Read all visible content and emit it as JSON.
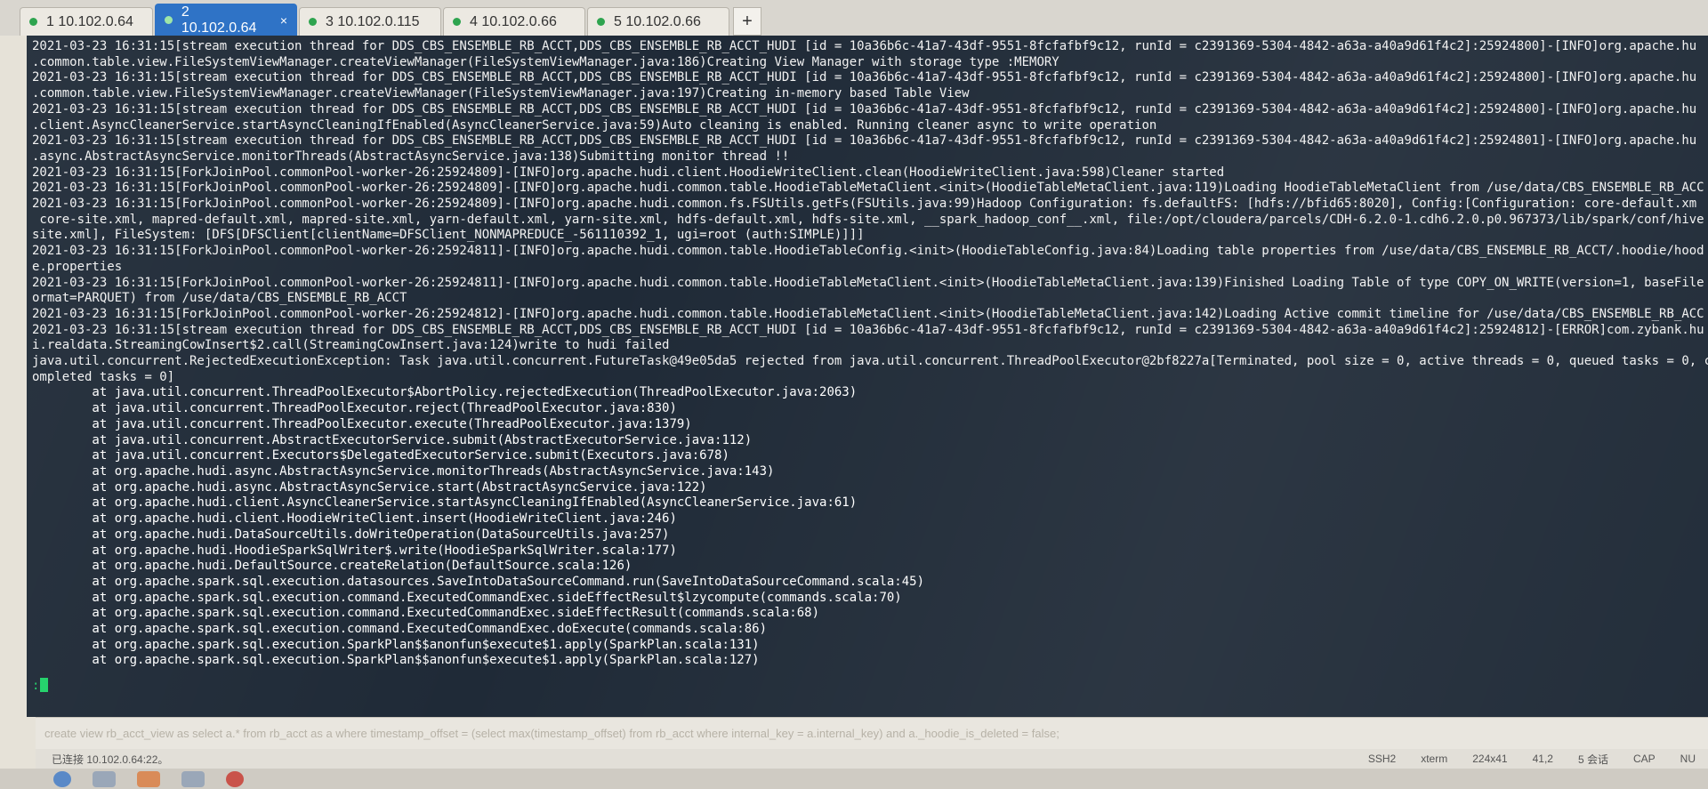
{
  "tabs": [
    {
      "label": "1 10.102.0.64",
      "active": false
    },
    {
      "label": "2 10.102.0.64",
      "active": true
    },
    {
      "label": "3 10.102.0.115",
      "active": false
    },
    {
      "label": "4 10.102.0.66",
      "active": false
    },
    {
      "label": "5 10.102.0.66",
      "active": false
    }
  ],
  "tab_add_label": "+",
  "tab_close_label": "×",
  "log_lines": [
    "2021-03-23 16:31:15[stream execution thread for DDS_CBS_ENSEMBLE_RB_ACCT,DDS_CBS_ENSEMBLE_RB_ACCT_HUDI [id = 10a36b6c-41a7-43df-9551-8fcfafbf9c12, runId = c2391369-5304-4842-a63a-a40a9d61f4c2]:25924800]-[INFO]org.apache.hu",
    ".common.table.view.FileSystemViewManager.createViewManager(FileSystemViewManager.java:186)Creating View Manager with storage type :MEMORY",
    "2021-03-23 16:31:15[stream execution thread for DDS_CBS_ENSEMBLE_RB_ACCT,DDS_CBS_ENSEMBLE_RB_ACCT_HUDI [id = 10a36b6c-41a7-43df-9551-8fcfafbf9c12, runId = c2391369-5304-4842-a63a-a40a9d61f4c2]:25924800]-[INFO]org.apache.hu",
    ".common.table.view.FileSystemViewManager.createViewManager(FileSystemViewManager.java:197)Creating in-memory based Table View",
    "2021-03-23 16:31:15[stream execution thread for DDS_CBS_ENSEMBLE_RB_ACCT,DDS_CBS_ENSEMBLE_RB_ACCT_HUDI [id = 10a36b6c-41a7-43df-9551-8fcfafbf9c12, runId = c2391369-5304-4842-a63a-a40a9d61f4c2]:25924800]-[INFO]org.apache.hu",
    ".client.AsyncCleanerService.startAsyncCleaningIfEnabled(AsyncCleanerService.java:59)Auto cleaning is enabled. Running cleaner async to write operation",
    "2021-03-23 16:31:15[stream execution thread for DDS_CBS_ENSEMBLE_RB_ACCT,DDS_CBS_ENSEMBLE_RB_ACCT_HUDI [id = 10a36b6c-41a7-43df-9551-8fcfafbf9c12, runId = c2391369-5304-4842-a63a-a40a9d61f4c2]:25924801]-[INFO]org.apache.hu",
    ".async.AbstractAsyncService.monitorThreads(AbstractAsyncService.java:138)Submitting monitor thread !!",
    "2021-03-23 16:31:15[ForkJoinPool.commonPool-worker-26:25924809]-[INFO]org.apache.hudi.client.HoodieWriteClient.clean(HoodieWriteClient.java:598)Cleaner started",
    "2021-03-23 16:31:15[ForkJoinPool.commonPool-worker-26:25924809]-[INFO]org.apache.hudi.common.table.HoodieTableMetaClient.<init>(HoodieTableMetaClient.java:119)Loading HoodieTableMetaClient from /use/data/CBS_ENSEMBLE_RB_ACC",
    "2021-03-23 16:31:15[ForkJoinPool.commonPool-worker-26:25924809]-[INFO]org.apache.hudi.common.fs.FSUtils.getFs(FSUtils.java:99)Hadoop Configuration: fs.defaultFS: [hdfs://bfid65:8020], Config:[Configuration: core-default.xm",
    " core-site.xml, mapred-default.xml, mapred-site.xml, yarn-default.xml, yarn-site.xml, hdfs-default.xml, hdfs-site.xml, __spark_hadoop_conf__.xml, file:/opt/cloudera/parcels/CDH-6.2.0-1.cdh6.2.0.p0.967373/lib/spark/conf/hive",
    "site.xml], FileSystem: [DFS[DFSClient[clientName=DFSClient_NONMAPREDUCE_-561110392_1, ugi=root (auth:SIMPLE)]]]",
    "2021-03-23 16:31:15[ForkJoinPool.commonPool-worker-26:25924811]-[INFO]org.apache.hudi.common.table.HoodieTableConfig.<init>(HoodieTableConfig.java:84)Loading table properties from /use/data/CBS_ENSEMBLE_RB_ACCT/.hoodie/hood",
    "e.properties",
    "2021-03-23 16:31:15[ForkJoinPool.commonPool-worker-26:25924811]-[INFO]org.apache.hudi.common.table.HoodieTableMetaClient.<init>(HoodieTableMetaClient.java:139)Finished Loading Table of type COPY_ON_WRITE(version=1, baseFile",
    "ormat=PARQUET) from /use/data/CBS_ENSEMBLE_RB_ACCT",
    "2021-03-23 16:31:15[ForkJoinPool.commonPool-worker-26:25924812]-[INFO]org.apache.hudi.common.table.HoodieTableMetaClient.<init>(HoodieTableMetaClient.java:142)Loading Active commit timeline for /use/data/CBS_ENSEMBLE_RB_ACC",
    "2021-03-23 16:31:15[stream execution thread for DDS_CBS_ENSEMBLE_RB_ACCT,DDS_CBS_ENSEMBLE_RB_ACCT_HUDI [id = 10a36b6c-41a7-43df-9551-8fcfafbf9c12, runId = c2391369-5304-4842-a63a-a40a9d61f4c2]:25924812]-[ERROR]com.zybank.hu",
    "i.realdata.StreamingCowInsert$2.call(StreamingCowInsert.java:124)write to hudi failed",
    "java.util.concurrent.RejectedExecutionException: Task java.util.concurrent.FutureTask@49e05da5 rejected from java.util.concurrent.ThreadPoolExecutor@2bf8227a[Terminated, pool size = 0, active threads = 0, queued tasks = 0, c",
    "ompleted tasks = 0]",
    "        at java.util.concurrent.ThreadPoolExecutor$AbortPolicy.rejectedExecution(ThreadPoolExecutor.java:2063)",
    "        at java.util.concurrent.ThreadPoolExecutor.reject(ThreadPoolExecutor.java:830)",
    "        at java.util.concurrent.ThreadPoolExecutor.execute(ThreadPoolExecutor.java:1379)",
    "        at java.util.concurrent.AbstractExecutorService.submit(AbstractExecutorService.java:112)",
    "        at java.util.concurrent.Executors$DelegatedExecutorService.submit(Executors.java:678)",
    "        at org.apache.hudi.async.AbstractAsyncService.monitorThreads(AbstractAsyncService.java:143)",
    "        at org.apache.hudi.async.AbstractAsyncService.start(AbstractAsyncService.java:122)",
    "        at org.apache.hudi.client.AsyncCleanerService.startAsyncCleaningIfEnabled(AsyncCleanerService.java:61)",
    "        at org.apache.hudi.client.HoodieWriteClient.insert(HoodieWriteClient.java:246)",
    "        at org.apache.hudi.DataSourceUtils.doWriteOperation(DataSourceUtils.java:257)",
    "        at org.apache.hudi.HoodieSparkSqlWriter$.write(HoodieSparkSqlWriter.scala:177)",
    "        at org.apache.hudi.DefaultSource.createRelation(DefaultSource.scala:126)",
    "        at org.apache.spark.sql.execution.datasources.SaveIntoDataSourceCommand.run(SaveIntoDataSourceCommand.scala:45)",
    "        at org.apache.spark.sql.execution.command.ExecutedCommandExec.sideEffectResult$lzycompute(commands.scala:70)",
    "        at org.apache.spark.sql.execution.command.ExecutedCommandExec.sideEffectResult(commands.scala:68)",
    "        at org.apache.spark.sql.execution.command.ExecutedCommandExec.doExecute(commands.scala:86)",
    "        at org.apache.spark.sql.execution.SparkPlan$$anonfun$execute$1.apply(SparkPlan.scala:131)",
    "        at org.apache.spark.sql.execution.SparkPlan$$anonfun$execute$1.apply(SparkPlan.scala:127)"
  ],
  "prompt": ":",
  "input_bar": {
    "text": "create view rb_acct_view as select a.* from rb_acct as a where timestamp_offset = (select max(timestamp_offset) from rb_acct where internal_key = a.internal_key) and a._hoodie_is_deleted = false;"
  },
  "status_bar": {
    "connection": "已连接 10.102.0.64:22。",
    "protocol": "SSH2",
    "terminal_type": "xterm",
    "size": "224x41",
    "cursor_pos": "41,2",
    "sessions": "5 会话",
    "caps": "CAP",
    "num": "NU"
  },
  "colors": {
    "terminal_bg": "#1f2a37",
    "terminal_fg": "#f2f2f2",
    "active_tab": "#2f73c6",
    "prompt": "#26d26d"
  }
}
